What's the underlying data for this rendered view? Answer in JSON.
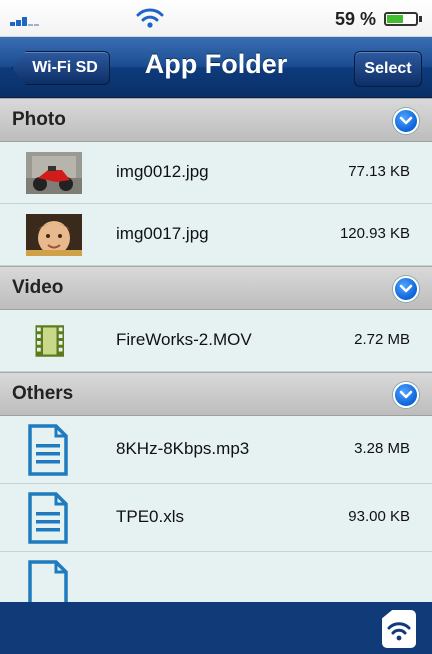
{
  "status_bar": {
    "battery_text": "59 %",
    "battery_level": 0.59,
    "signal_icon": "signal-bars-icon",
    "wifi_icon": "wifi-icon"
  },
  "nav": {
    "back_label": "Wi-Fi SD",
    "title": "App Folder",
    "select_label": "Select"
  },
  "sections": {
    "photo": {
      "label": "Photo",
      "items": [
        {
          "name": "img0012.jpg",
          "size": "77.13 KB",
          "icon": "photo-thumbnail-motorcycle"
        },
        {
          "name": "img0017.jpg",
          "size": "120.93 KB",
          "icon": "photo-thumbnail-child"
        }
      ]
    },
    "video": {
      "label": "Video",
      "items": [
        {
          "name": "FireWorks-2.MOV",
          "size": "2.72 MB",
          "icon": "film-strip-icon"
        }
      ]
    },
    "others": {
      "label": "Others",
      "items": [
        {
          "name": "8KHz-8Kbps.mp3",
          "size": "3.28 MB",
          "icon": "document-icon"
        },
        {
          "name": "TPE0.xls",
          "size": "93.00 KB",
          "icon": "document-icon"
        }
      ]
    }
  },
  "colors": {
    "nav_blue": "#1b4d92",
    "toolbar_blue": "#103a78",
    "row_bg": "#e6f2f2",
    "accent": "#0d63d8"
  }
}
